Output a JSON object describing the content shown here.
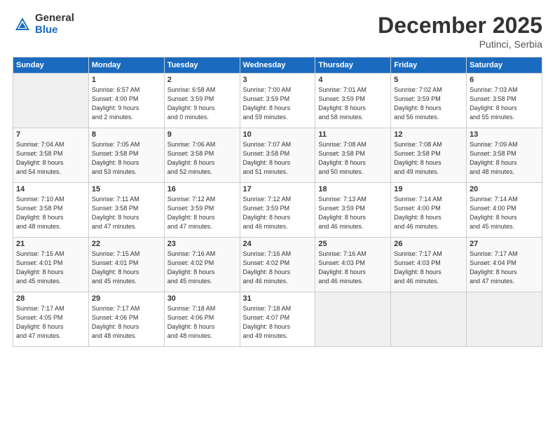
{
  "header": {
    "logo_general": "General",
    "logo_blue": "Blue",
    "title": "December 2025",
    "subtitle": "Putinci, Serbia"
  },
  "days_of_week": [
    "Sunday",
    "Monday",
    "Tuesday",
    "Wednesday",
    "Thursday",
    "Friday",
    "Saturday"
  ],
  "weeks": [
    [
      {
        "num": "",
        "info": ""
      },
      {
        "num": "1",
        "info": "Sunrise: 6:57 AM\nSunset: 4:00 PM\nDaylight: 9 hours\nand 2 minutes."
      },
      {
        "num": "2",
        "info": "Sunrise: 6:58 AM\nSunset: 3:59 PM\nDaylight: 9 hours\nand 0 minutes."
      },
      {
        "num": "3",
        "info": "Sunrise: 7:00 AM\nSunset: 3:59 PM\nDaylight: 8 hours\nand 59 minutes."
      },
      {
        "num": "4",
        "info": "Sunrise: 7:01 AM\nSunset: 3:59 PM\nDaylight: 8 hours\nand 58 minutes."
      },
      {
        "num": "5",
        "info": "Sunrise: 7:02 AM\nSunset: 3:59 PM\nDaylight: 8 hours\nand 56 minutes."
      },
      {
        "num": "6",
        "info": "Sunrise: 7:03 AM\nSunset: 3:58 PM\nDaylight: 8 hours\nand 55 minutes."
      }
    ],
    [
      {
        "num": "7",
        "info": "Sunrise: 7:04 AM\nSunset: 3:58 PM\nDaylight: 8 hours\nand 54 minutes."
      },
      {
        "num": "8",
        "info": "Sunrise: 7:05 AM\nSunset: 3:58 PM\nDaylight: 8 hours\nand 53 minutes."
      },
      {
        "num": "9",
        "info": "Sunrise: 7:06 AM\nSunset: 3:58 PM\nDaylight: 8 hours\nand 52 minutes."
      },
      {
        "num": "10",
        "info": "Sunrise: 7:07 AM\nSunset: 3:58 PM\nDaylight: 8 hours\nand 51 minutes."
      },
      {
        "num": "11",
        "info": "Sunrise: 7:08 AM\nSunset: 3:58 PM\nDaylight: 8 hours\nand 50 minutes."
      },
      {
        "num": "12",
        "info": "Sunrise: 7:08 AM\nSunset: 3:58 PM\nDaylight: 8 hours\nand 49 minutes."
      },
      {
        "num": "13",
        "info": "Sunrise: 7:09 AM\nSunset: 3:58 PM\nDaylight: 8 hours\nand 48 minutes."
      }
    ],
    [
      {
        "num": "14",
        "info": "Sunrise: 7:10 AM\nSunset: 3:58 PM\nDaylight: 8 hours\nand 48 minutes."
      },
      {
        "num": "15",
        "info": "Sunrise: 7:11 AM\nSunset: 3:58 PM\nDaylight: 8 hours\nand 47 minutes."
      },
      {
        "num": "16",
        "info": "Sunrise: 7:12 AM\nSunset: 3:59 PM\nDaylight: 8 hours\nand 47 minutes."
      },
      {
        "num": "17",
        "info": "Sunrise: 7:12 AM\nSunset: 3:59 PM\nDaylight: 8 hours\nand 46 minutes."
      },
      {
        "num": "18",
        "info": "Sunrise: 7:13 AM\nSunset: 3:59 PM\nDaylight: 8 hours\nand 46 minutes."
      },
      {
        "num": "19",
        "info": "Sunrise: 7:14 AM\nSunset: 4:00 PM\nDaylight: 8 hours\nand 46 minutes."
      },
      {
        "num": "20",
        "info": "Sunrise: 7:14 AM\nSunset: 4:00 PM\nDaylight: 8 hours\nand 45 minutes."
      }
    ],
    [
      {
        "num": "21",
        "info": "Sunrise: 7:15 AM\nSunset: 4:01 PM\nDaylight: 8 hours\nand 45 minutes."
      },
      {
        "num": "22",
        "info": "Sunrise: 7:15 AM\nSunset: 4:01 PM\nDaylight: 8 hours\nand 45 minutes."
      },
      {
        "num": "23",
        "info": "Sunrise: 7:16 AM\nSunset: 4:02 PM\nDaylight: 8 hours\nand 45 minutes."
      },
      {
        "num": "24",
        "info": "Sunrise: 7:16 AM\nSunset: 4:02 PM\nDaylight: 8 hours\nand 46 minutes."
      },
      {
        "num": "25",
        "info": "Sunrise: 7:16 AM\nSunset: 4:03 PM\nDaylight: 8 hours\nand 46 minutes."
      },
      {
        "num": "26",
        "info": "Sunrise: 7:17 AM\nSunset: 4:03 PM\nDaylight: 8 hours\nand 46 minutes."
      },
      {
        "num": "27",
        "info": "Sunrise: 7:17 AM\nSunset: 4:04 PM\nDaylight: 8 hours\nand 47 minutes."
      }
    ],
    [
      {
        "num": "28",
        "info": "Sunrise: 7:17 AM\nSunset: 4:05 PM\nDaylight: 8 hours\nand 47 minutes."
      },
      {
        "num": "29",
        "info": "Sunrise: 7:17 AM\nSunset: 4:06 PM\nDaylight: 8 hours\nand 48 minutes."
      },
      {
        "num": "30",
        "info": "Sunrise: 7:18 AM\nSunset: 4:06 PM\nDaylight: 8 hours\nand 48 minutes."
      },
      {
        "num": "31",
        "info": "Sunrise: 7:18 AM\nSunset: 4:07 PM\nDaylight: 8 hours\nand 49 minutes."
      },
      {
        "num": "",
        "info": ""
      },
      {
        "num": "",
        "info": ""
      },
      {
        "num": "",
        "info": ""
      }
    ]
  ]
}
